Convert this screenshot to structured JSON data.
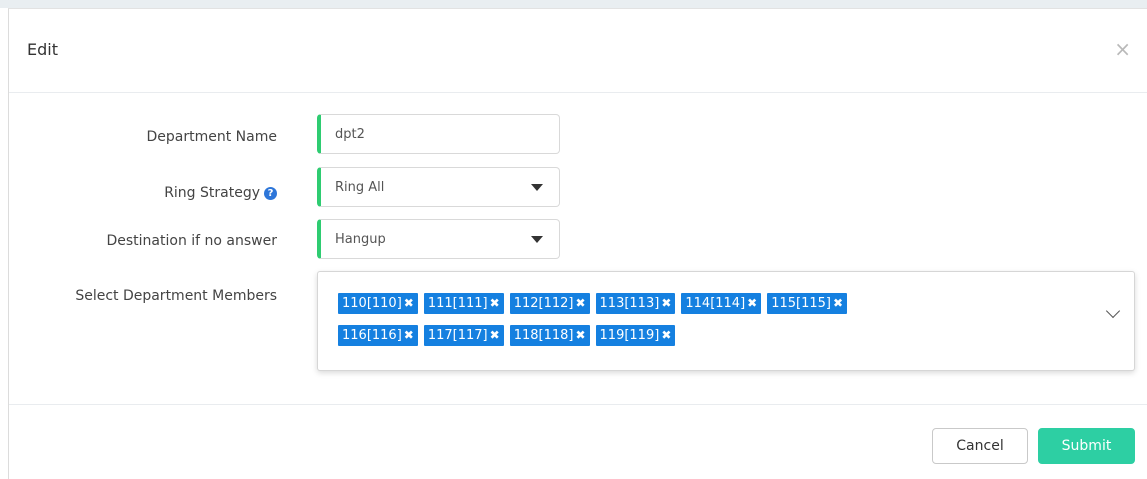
{
  "modal": {
    "title": "Edit",
    "close_glyph": "×"
  },
  "form": {
    "department_name": {
      "label": "Department Name",
      "value": "dpt2"
    },
    "ring_strategy": {
      "label": "Ring Strategy",
      "value": "Ring All",
      "help_icon": "question-circle-icon"
    },
    "destination": {
      "label": "Destination if no answer",
      "value": "Hangup"
    },
    "members": {
      "label": "Select Department Members",
      "tags": [
        "110[110]",
        "111[111]",
        "112[112]",
        "113[113]",
        "114[114]",
        "115[115]",
        "116[116]",
        "117[117]",
        "118[118]",
        "119[119]"
      ]
    }
  },
  "footer": {
    "cancel_label": "Cancel",
    "submit_label": "Submit"
  },
  "colors": {
    "accent_green": "#2ecc71",
    "tag_blue": "#1580e0",
    "submit_teal": "#2dcfa3"
  }
}
